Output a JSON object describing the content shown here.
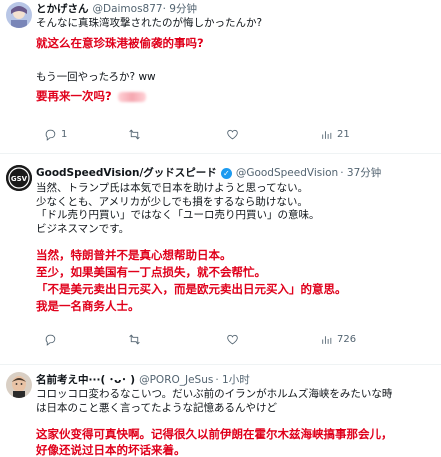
{
  "tweet1": {
    "name": "とかげさん",
    "handle": "@Daimos877",
    "time": "· 9分钟",
    "jp_line1": "そんなに真珠湾攻撃されたのが悔しかったんか?",
    "cn_line1": "就这么在意珍珠港被偷袭的事吗?",
    "jp_line2": "もう一回やったろか? ww",
    "cn_line2": "要再来一次吗?",
    "reply_count": "1",
    "retweet_count": "",
    "like_count": "",
    "view_count": "21"
  },
  "tweet2": {
    "name": "GoodSpeedVision/グッドスピード",
    "handle": "@GoodSpeedVision",
    "time": "· 37分钟",
    "avatar_text": "GSV",
    "jp_lines": [
      "当然、トランプ氏は本気で日本を助けようと思ってない。",
      "少なくとも、アメリカが少しでも損をするなら助けない。",
      "「ドル売り円買い」ではなく「ユーロ売り円買い」の意味。",
      "ビジネスマンです。"
    ],
    "cn_lines": [
      "当然，特朗普并不是真心想帮助日本。",
      "至少，如果美国有一丁点损失，就不会帮忙。",
      "「不是美元卖出日元买入，而是欧元卖出日元买入」的意思。",
      "我是一名商务人士。"
    ],
    "reply_count": "",
    "retweet_count": "",
    "like_count": "",
    "view_count": "726"
  },
  "tweet3": {
    "name": "名前考え中···( ･ᴗ･ )",
    "handle": "@PORO_JeSus",
    "time": "· 1小时",
    "jp_line1": "コロッコロ変わるなこいつ。だいぶ前のイランがホルムズ海峡をみたいな時",
    "jp_line2": "は日本のこと悪く言ってたような記憶あるんやけど",
    "cn_line1": "这家伙变得可真快啊。记得很久以前伊朗在霍尔木兹海峡搞事那会儿，",
    "cn_line2": "好像还说过日本的坏话来着。"
  },
  "colors": {
    "red_text": "#e0001b",
    "gray_text": "#536471",
    "verified": "#1d9bf0"
  },
  "icons": [
    "reply-icon",
    "retweet-icon",
    "like-icon",
    "views-icon",
    "verified-badge-icon"
  ]
}
